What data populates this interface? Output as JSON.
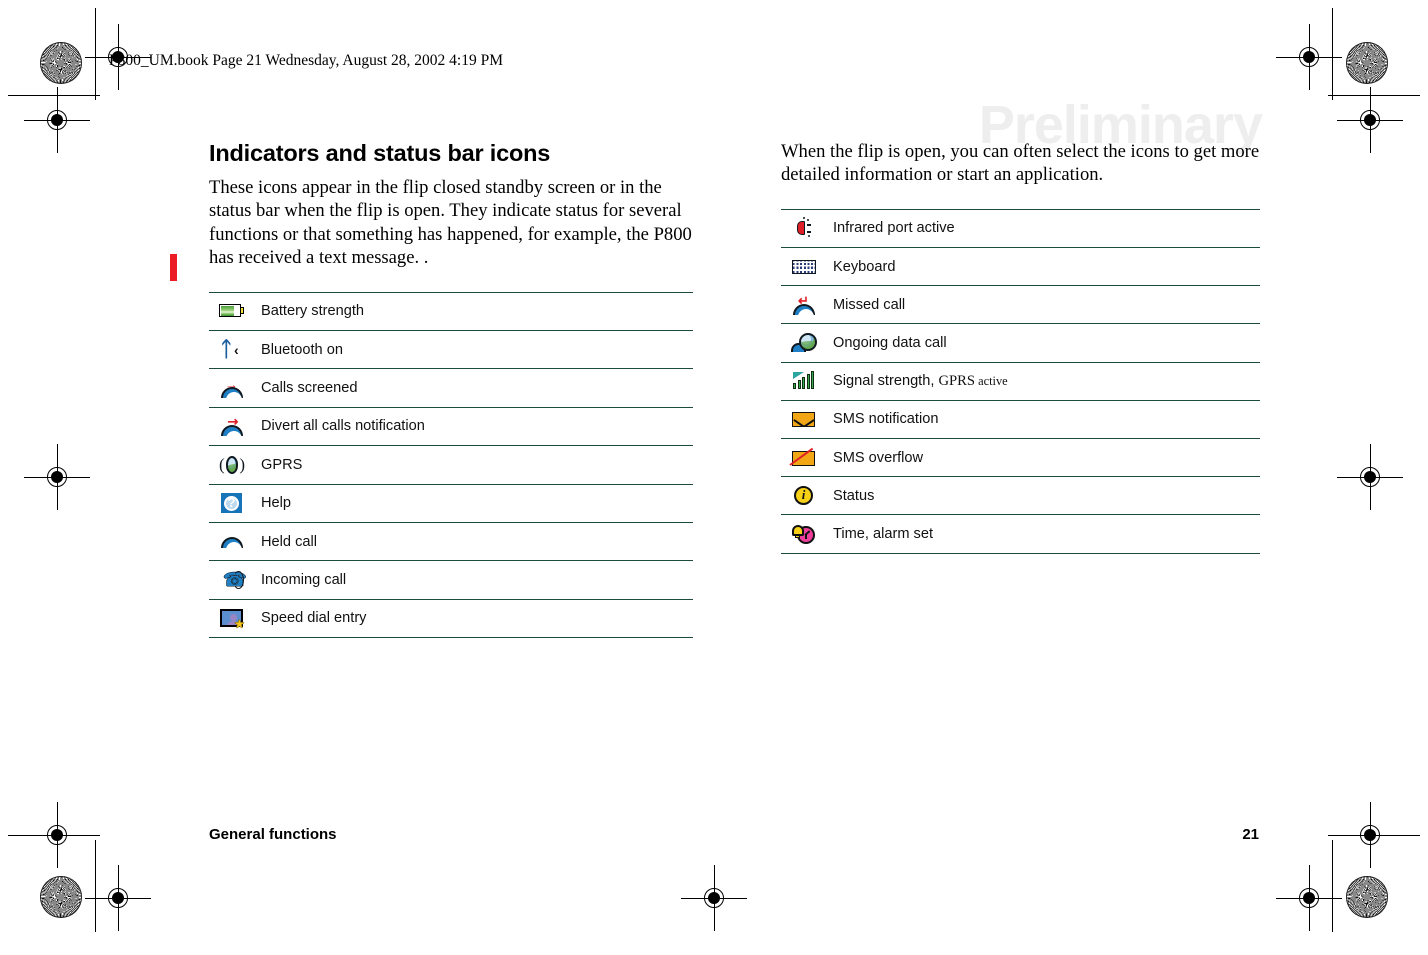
{
  "document": {
    "file_header": "P800_UM.book  Page 21  Wednesday, August 28, 2002  4:19 PM",
    "watermark": "Preliminary",
    "footer_left": "General functions",
    "footer_page": "21"
  },
  "left_column": {
    "title": "Indicators and status bar icons",
    "intro": "These icons appear in the flip closed standby screen or in the status bar when the flip is open. They indicate status for several functions or that something has happened, for example, the P800 has received a text message. .",
    "rows": [
      {
        "icon": "battery-strength-icon",
        "label": "Battery strength"
      },
      {
        "icon": "bluetooth-on-icon",
        "label": "Bluetooth on"
      },
      {
        "icon": "calls-screened-icon",
        "label": "Calls screened"
      },
      {
        "icon": "divert-all-calls-icon",
        "label": "Divert all calls notification"
      },
      {
        "icon": "gprs-icon",
        "label": "GPRS"
      },
      {
        "icon": "help-icon",
        "label": "Help"
      },
      {
        "icon": "held-call-icon",
        "label": "Held call"
      },
      {
        "icon": "incoming-call-icon",
        "label": "Incoming call"
      },
      {
        "icon": "speed-dial-entry-icon",
        "label": "Speed dial entry"
      }
    ]
  },
  "right_column": {
    "intro": "When the flip is open, you can often select the icons to get more detailed information or start an application.",
    "rows": [
      {
        "icon": "infrared-port-active-icon",
        "label": "Infrared port active"
      },
      {
        "icon": "keyboard-icon",
        "label": "Keyboard"
      },
      {
        "icon": "missed-call-icon",
        "label": "Missed call"
      },
      {
        "icon": "ongoing-data-call-icon",
        "label": "Ongoing data call"
      },
      {
        "icon": "signal-strength-gprs-icon",
        "label_part1": "Signal strength, ",
        "label_part2": "GPRS",
        "label_part3": " active"
      },
      {
        "icon": "sms-notification-icon",
        "label": "SMS notification"
      },
      {
        "icon": "sms-overflow-icon",
        "label": "SMS overflow"
      },
      {
        "icon": "status-icon",
        "label": "Status"
      },
      {
        "icon": "time-alarm-set-icon",
        "label": "Time, alarm set"
      }
    ]
  },
  "colors": {
    "rule": "#1d4a3e",
    "change_bar": "#ec1c24",
    "watermark": "#eeeeee",
    "battery_green": "#4aa03c",
    "bluetooth_blue": "#1a5c9e",
    "help_blue": "#1874b8",
    "alarm_magenta": "#ef3f9b",
    "status_yellow": "#f7d117",
    "envelope_orange": "#f2a615"
  }
}
